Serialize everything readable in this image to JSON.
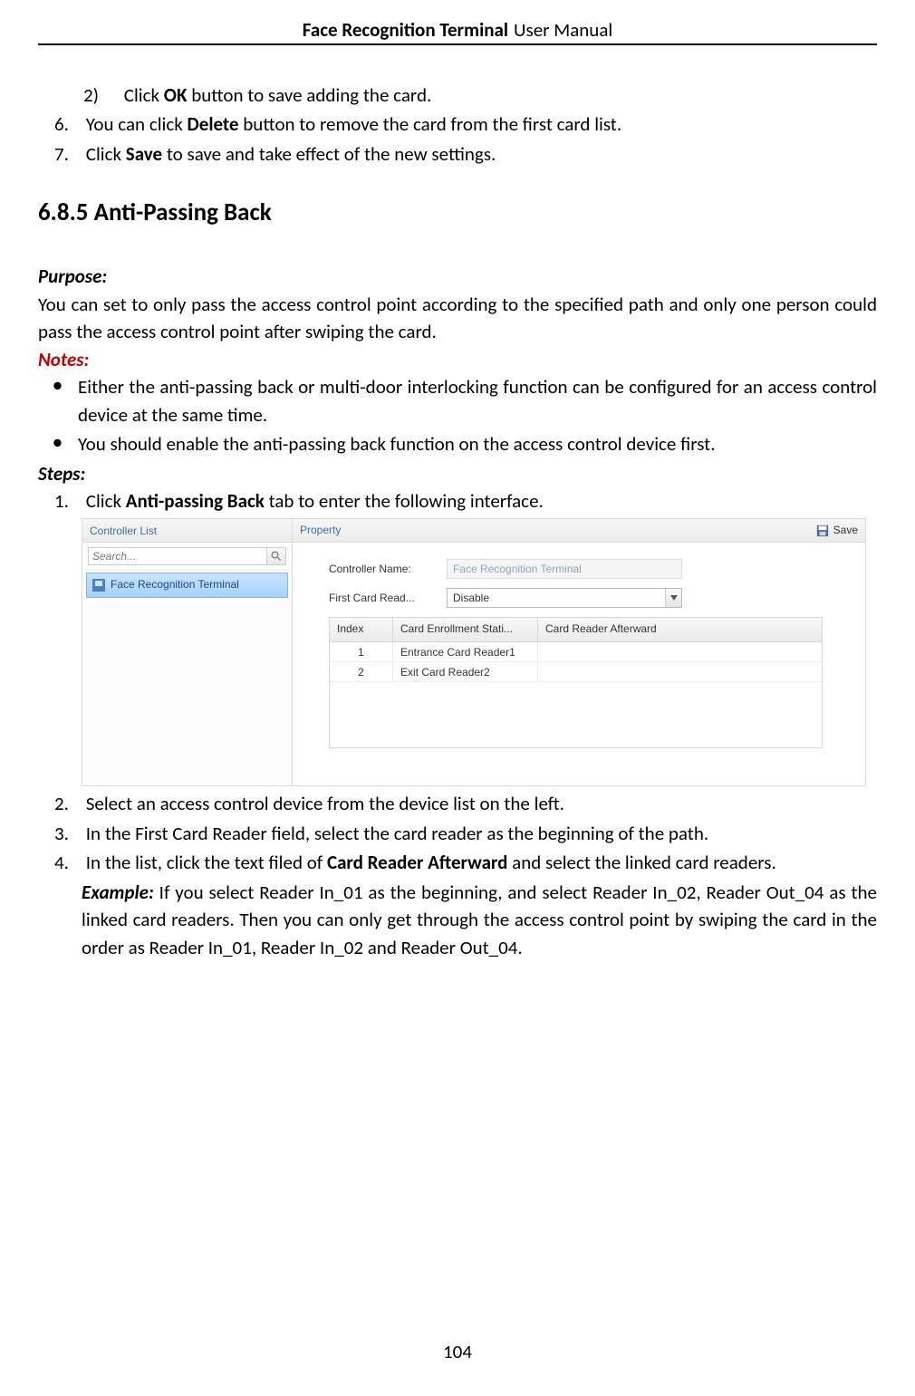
{
  "header": {
    "title": "Face Recognition Terminal",
    "sub": "User Manual"
  },
  "intro": {
    "sub2_num": "2)",
    "sub2_a": "Click ",
    "sub2_b": "OK",
    "sub2_c": " button to save adding the card.",
    "i6_num": "6.",
    "i6_a": "You can click ",
    "i6_b": "Delete",
    "i6_c": " button to remove the card from the first card list.",
    "i7_num": "7.",
    "i7_a": "Click ",
    "i7_b": "Save",
    "i7_c": " to save and take effect of the new settings."
  },
  "section": {
    "heading": "6.8.5   Anti-Passing Back"
  },
  "purpose": {
    "label": "Purpose:",
    "text": "You can set to only pass the access control point according to the specified path and only one person could pass the access control point after swiping the card."
  },
  "notes": {
    "label": "Notes:",
    "n1": "Either the anti-passing back or multi-door interlocking function can be configured for an access control device at the same time.",
    "n2": "You should enable the anti-passing back function on the access control device first."
  },
  "steps": {
    "label": "Steps:",
    "s1_num": "1.",
    "s1_a": "Click ",
    "s1_b": "Anti-passing Back",
    "s1_c": " tab to enter the following interface.",
    "s2_num": "2.",
    "s2": "Select an access control device from the device list on the left.",
    "s3_num": "3.",
    "s3": "In the First Card Reader field, select the card reader as the beginning of the path.",
    "s4_num": "4.",
    "s4_a": "In the list, click the text filed of ",
    "s4_b": "Card Reader Afterward",
    "s4_c": " and select the linked card readers.",
    "ex_label": "Example:",
    "ex_text": " If you select Reader In_01 as the beginning, and select Reader In_02, Reader Out_04 as the linked card readers. Then you can only get through the access control point by swiping the card in the order as Reader In_01, Reader In_02 and Reader Out_04."
  },
  "ui": {
    "controller_list": "Controller List",
    "property": "Property",
    "save": "Save",
    "search_placeholder": "Search...",
    "device": "Face Recognition Terminal",
    "form": {
      "controller_name_label": "Controller Name:",
      "controller_name_value": "Face Recognition Terminal",
      "first_card_label": "First Card Read...",
      "first_card_value": "Disable"
    },
    "grid": {
      "h1": "Index",
      "h2": "Card Enrollment Stati...",
      "h3": "Card Reader Afterward",
      "rows": [
        {
          "index": "1",
          "station": "Entrance Card Reader1",
          "after": ""
        },
        {
          "index": "2",
          "station": "Exit Card Reader2",
          "after": ""
        }
      ]
    }
  },
  "pagenum": "104"
}
